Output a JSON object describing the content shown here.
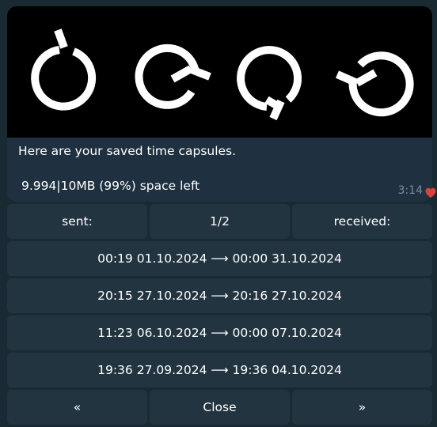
{
  "message": {
    "text": "Here are your saved time capsules.",
    "quota": "9.994|10MB (99%) space left",
    "time": "3:14",
    "reaction_icon": "heart-icon",
    "media_icons": [
      "clock-rewind-icon",
      "clock-rewind-icon",
      "clock-rewind-icon",
      "clock-rewind-icon"
    ]
  },
  "keyboard": {
    "tabs": {
      "sent": "sent:",
      "page": "1/2",
      "received": "received:"
    },
    "capsules": [
      "00:19 01.10.2024 ⟶ 00:00 31.10.2024",
      "20:15 27.10.2024 ⟶ 20:16 27.10.2024",
      "11:23 06.10.2024 ⟶ 00:00 07.10.2024",
      "19:36 27.09.2024 ⟶ 19:36 04.10.2024"
    ],
    "nav": {
      "prev": "«",
      "close": "Close",
      "next": "»"
    }
  },
  "colors": {
    "bubble": "#1f3040",
    "button": "#233441",
    "reaction": "#e0403c"
  }
}
